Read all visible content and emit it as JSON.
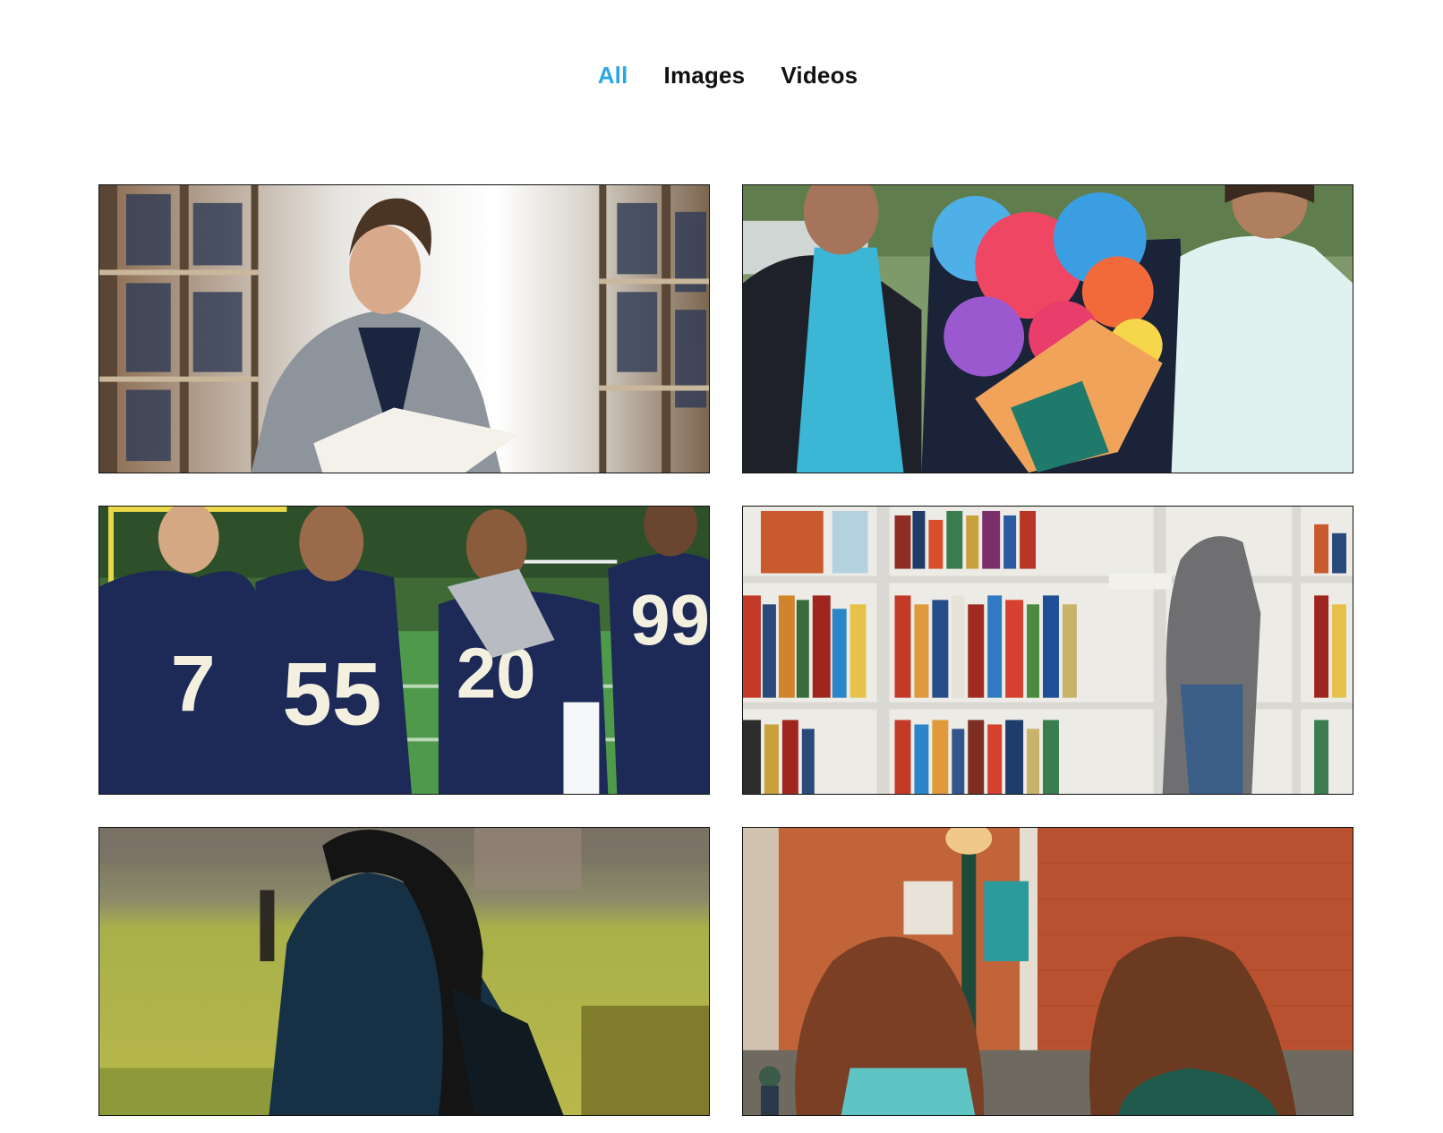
{
  "filters": {
    "all_label": "All",
    "images_label": "Images",
    "videos_label": "Videos",
    "active": "All",
    "active_color": "#2aa7e6"
  },
  "gallery": {
    "items": [
      {
        "subject": "student-reading-in-library"
      },
      {
        "subject": "graduation-family-with-lei"
      },
      {
        "subject": "football-players-team"
      },
      {
        "subject": "library-bookshelves"
      },
      {
        "subject": "student-on-campus-lawn"
      },
      {
        "subject": "students-walking-campus"
      }
    ]
  }
}
